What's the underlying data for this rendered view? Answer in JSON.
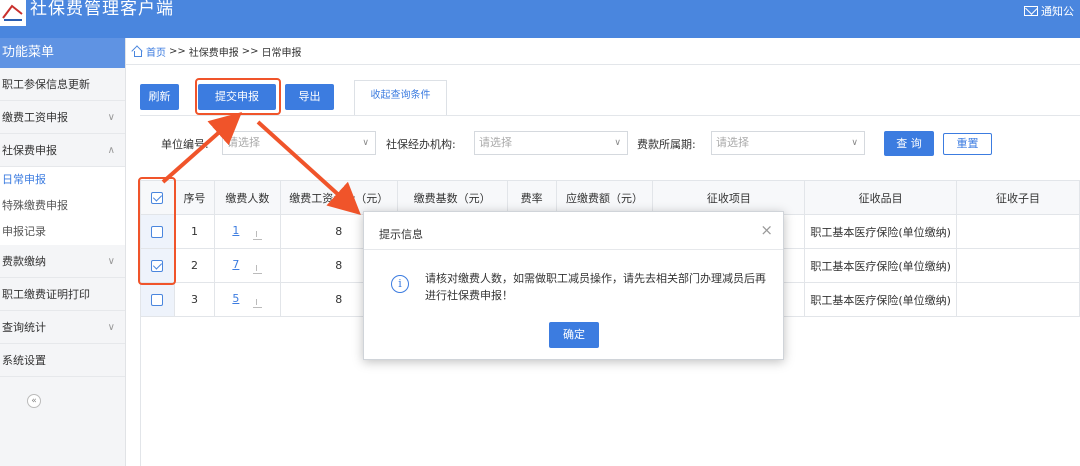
{
  "header": {
    "app_title": "社保费管理客户端",
    "notify_label": "通知公"
  },
  "sidebar": {
    "title": "功能菜单",
    "items": [
      {
        "label": "职工参保信息更新",
        "chevron": ""
      },
      {
        "label": "缴费工资申报",
        "chevron": "∨"
      },
      {
        "label": "社保费申报",
        "chevron": "∧"
      }
    ],
    "subitems": [
      "日常申报",
      "特殊缴费申报",
      "申报记录"
    ],
    "items2": [
      {
        "label": "费款缴纳",
        "chevron": "∨"
      },
      {
        "label": "职工缴费证明打印",
        "chevron": ""
      },
      {
        "label": "查询统计",
        "chevron": "∨"
      },
      {
        "label": "系统设置",
        "chevron": ""
      }
    ],
    "collapse_label": "«"
  },
  "breadcrumb": {
    "home": "首页",
    "sep": ">>",
    "level1": "社保费申报",
    "level2": "日常申报"
  },
  "toolbar": {
    "refresh": "刷新",
    "submit": "提交申报",
    "export": "导出",
    "collapse_tab": "收起查询条件"
  },
  "filters": {
    "unit_label": "单位编号:",
    "unit_placeholder": "请选择",
    "agency_label": "社保经办机构:",
    "agency_placeholder": "请选择",
    "period_label": "费款所属期:",
    "period_placeholder": "请选择",
    "query": "查 询",
    "reset": "重置"
  },
  "table": {
    "headers": [
      "序号",
      "缴费人数",
      "缴费工资合计（元）",
      "缴费基数（元）",
      "费率",
      "应缴费额（元）",
      "征收项目",
      "征收品目",
      "征收子目"
    ],
    "rows": [
      {
        "checked": false,
        "no": "1",
        "count": "1",
        "wage": "8",
        "item": "职工基本医疗保险(单位缴纳)"
      },
      {
        "checked": true,
        "no": "2",
        "count": "7",
        "wage": "8",
        "item": "职工基本医疗保险(单位缴纳)"
      },
      {
        "checked": false,
        "no": "3",
        "count": "5",
        "wage": "8",
        "item": "职工基本医疗保险(单位缴纳)"
      }
    ]
  },
  "modal": {
    "title": "提示信息",
    "close": "×",
    "message": "请核对缴费人数，如需做职工减员操作，请先去相关部门办理减员后再进行社保费申报！",
    "ok": "确定",
    "info_icon": "i"
  },
  "colors": {
    "primary": "#3c7ce0",
    "header": "#4a86de",
    "annotation": "#f0542a"
  }
}
